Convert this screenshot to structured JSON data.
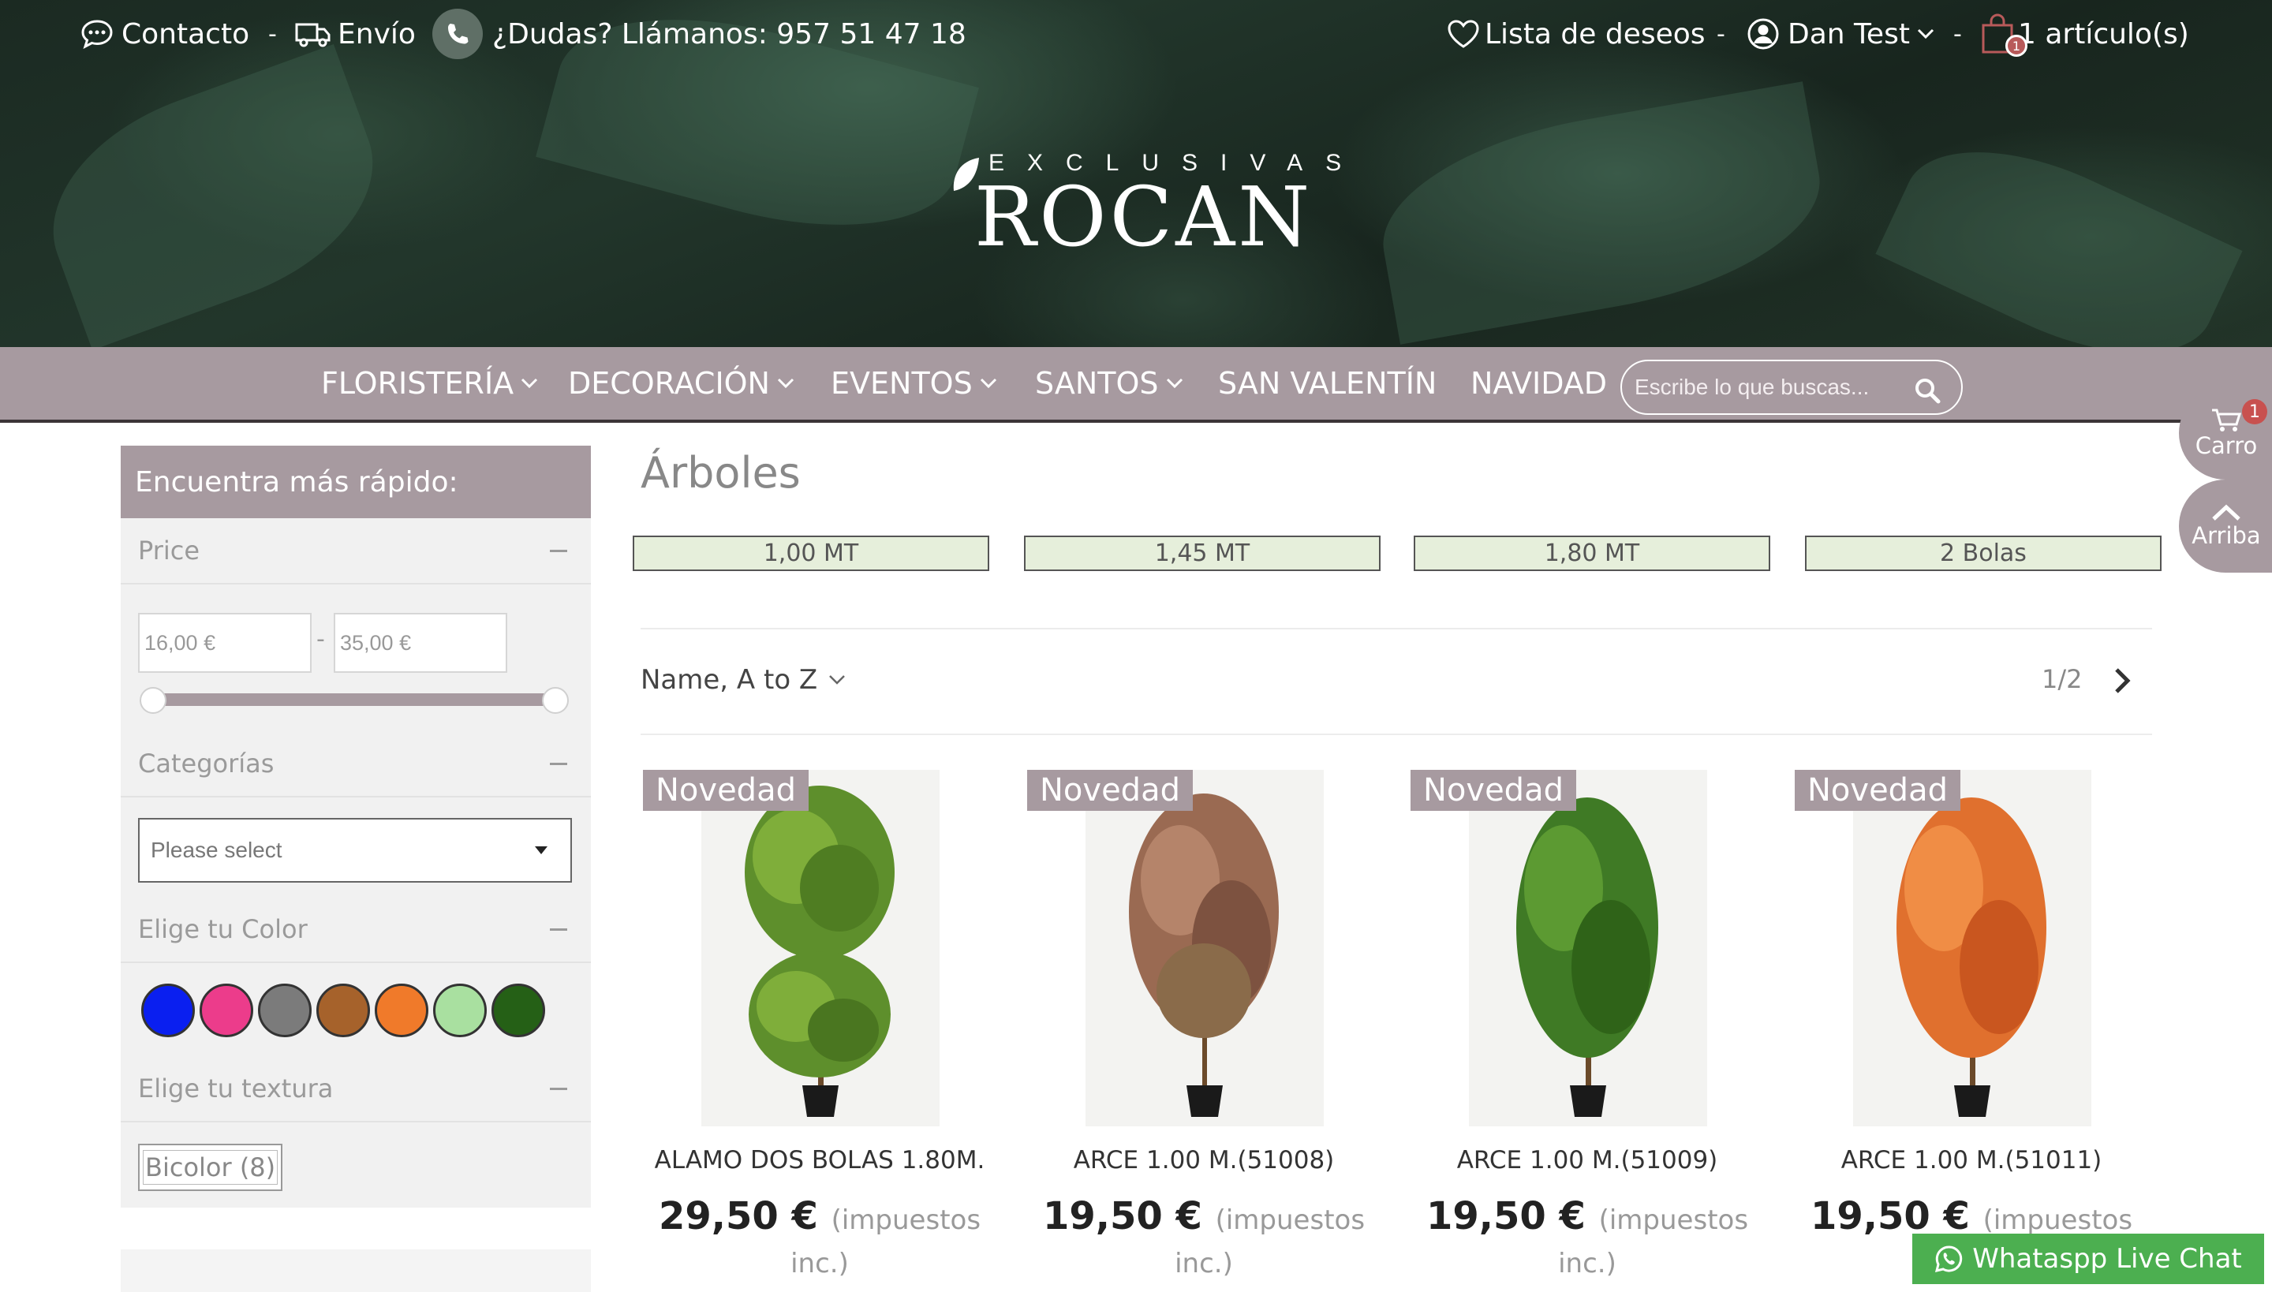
{
  "topbar": {
    "contact": "Contacto",
    "shipping": "Envío",
    "phone": "¿Dudas? Llámanos: 957 51 47 18",
    "wishlist": "Lista de deseos",
    "user": "Dan Test",
    "cart": "1 artículo(s)",
    "cart_count": "1",
    "separator": "-"
  },
  "logo": {
    "sub": "EXCLUSIVAS",
    "main": "ROCAN"
  },
  "nav": {
    "items": [
      "FLORISTERÍA",
      "DECORACIÓN",
      "EVENTOS",
      "SANTOS",
      "SAN VALENTÍN",
      "NAVIDAD"
    ],
    "search_placeholder": "Escribe lo que buscas..."
  },
  "floating": {
    "cart_label": "Carro",
    "cart_count": "1",
    "top_label": "Arriba"
  },
  "sidebar": {
    "heading": "Encuentra más rápido:",
    "price_label": "Price",
    "price_min": "16,00 €",
    "price_max": "35,00 €",
    "price_dash": "-",
    "categories_label": "Categorías",
    "categories_select": "Please select",
    "color_label": "Elige tu Color",
    "colors": [
      "#0a1ff0",
      "#ec3c8b",
      "#7b7b7b",
      "#a6622b",
      "#f07a2a",
      "#a9e0a0",
      "#256016"
    ],
    "texture_label": "Elige tu textura",
    "texture_tag": "Bicolor (8)"
  },
  "main": {
    "title": "Árboles",
    "subcategories": [
      "1,00 MT",
      "1,45 MT",
      "1,80 MT",
      "2 Bolas"
    ],
    "sort": "Name, A to Z",
    "pagination": "1/2",
    "products": [
      {
        "badge": "Novedad",
        "name": "ALAMO DOS BOLAS 1.80M.",
        "price": "29,50 €",
        "tax": "(impuestos",
        "tax2": "inc.)"
      },
      {
        "badge": "Novedad",
        "name": "ARCE 1.00 M.(51008)",
        "price": "19,50 €",
        "tax": "(impuestos",
        "tax2": "inc.)"
      },
      {
        "badge": "Novedad",
        "name": "ARCE 1.00 M.(51009)",
        "price": "19,50 €",
        "tax": "(impuestos",
        "tax2": "inc.)"
      },
      {
        "badge": "Novedad",
        "name": "ARCE 1.00 M.(51011)",
        "price": "19,50 €",
        "tax": "(impuestos",
        "tax2": ""
      }
    ]
  },
  "whatsapp": "Whataspp Live Chat"
}
